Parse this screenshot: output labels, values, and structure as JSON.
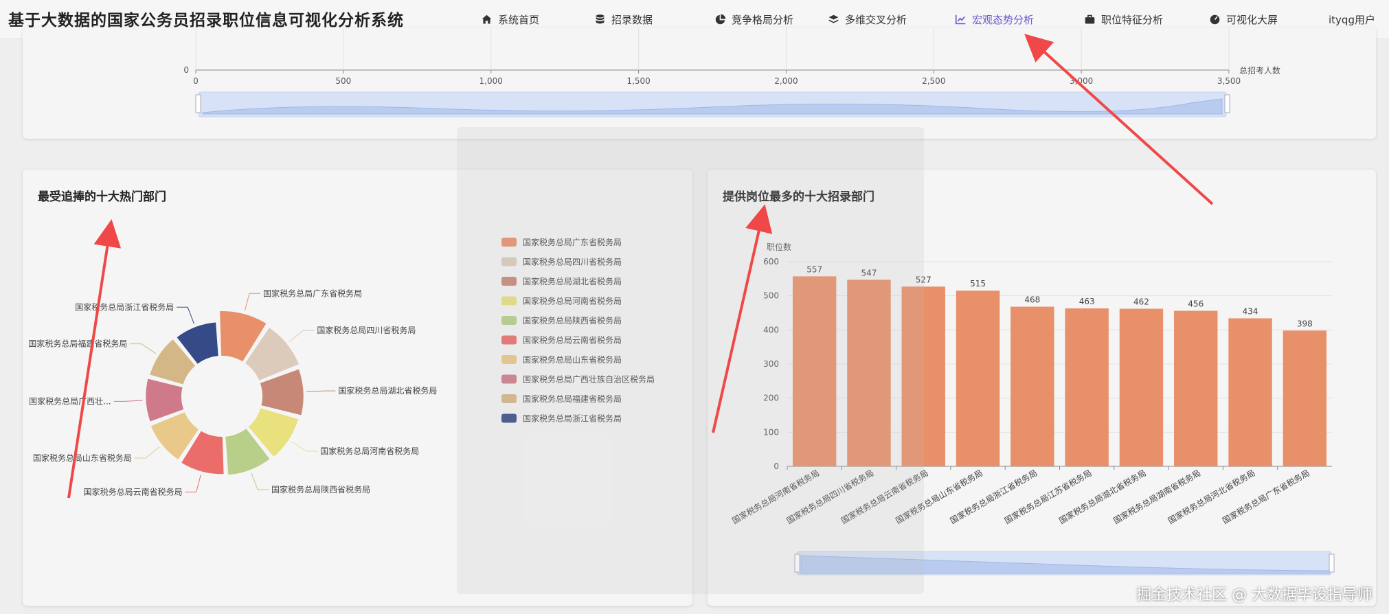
{
  "app": {
    "title": "基于大数据的国家公务员招录职位信息可视化分析系统"
  },
  "nav": {
    "items": [
      {
        "label": "系统首页",
        "icon": "home-icon",
        "active": false
      },
      {
        "label": "招录数据",
        "icon": "database-icon",
        "active": false
      },
      {
        "label": "竞争格局分析",
        "icon": "pie-chart-icon",
        "active": false
      },
      {
        "label": "多维交叉分析",
        "icon": "layers-icon",
        "active": false
      },
      {
        "label": "宏观态势分析",
        "icon": "line-chart-icon",
        "active": true
      },
      {
        "label": "职位特征分析",
        "icon": "briefcase-icon",
        "active": false
      },
      {
        "label": "可视化大屏",
        "icon": "dashboard-icon",
        "active": false
      }
    ],
    "user": "ityqg用户"
  },
  "colors": {
    "accent": "#6a5acd",
    "bar": "#e8906a",
    "pie": [
      "#e8906a",
      "#dccbbb",
      "#c78878",
      "#e9e07e",
      "#b8cf8a",
      "#ea6d6a",
      "#e9c98a",
      "#cf7a8a",
      "#d3b786",
      "#354a86"
    ],
    "arrow": "#f04848"
  },
  "chart_data": [
    {
      "type": "line",
      "title": "",
      "xlabel": "总招考人数",
      "x_ticks": [
        "0",
        "500",
        "1,000",
        "1,500",
        "2,000",
        "2,500",
        "3,000",
        "3,500"
      ],
      "xlim": [
        0,
        3500
      ],
      "y_ticks": [
        "0"
      ],
      "has_datazoom": true
    },
    {
      "type": "pie",
      "title": "最受追捧的十大热门部门",
      "donut": true,
      "labels": [
        "国家税务总局广东省税务局",
        "国家税务总局四川省税务局",
        "国家税务总局湖北省税务局",
        "国家税务总局河南省税务局",
        "国家税务总局陕西省税务局",
        "国家税务总局云南省税务局",
        "国家税务总局山东省税务局",
        "国家税务总局广西壮族自治区税务局",
        "国家税务总局福建省税务局",
        "国家税务总局浙江省税务局"
      ],
      "outer_labels": [
        "国家税务总局广东省税务局",
        "国家税务总局四川省税务局",
        "国家税务总局湖北省税务局",
        "国家税务总局河南省税务局",
        "国家税务总局陕西省税务局",
        "国家税务总局云南省税务局",
        "国家税务总局山东省税务局",
        "国家税务总局广西壮...",
        "国家税务总局福建省税务局",
        "国家税务总局浙江省税务局"
      ],
      "values": [
        1,
        1,
        1,
        1,
        1,
        1,
        1,
        1,
        1,
        1
      ],
      "radius_fraction": [
        1.0,
        0.96,
        0.92,
        0.88,
        0.86,
        0.84,
        0.82,
        0.8,
        0.78,
        0.76
      ],
      "legend": "right"
    },
    {
      "type": "bar",
      "title": "提供岗位最多的十大招录部门",
      "ylabel": "职位数",
      "ylim": [
        0,
        600
      ],
      "y_ticks": [
        0,
        100,
        200,
        300,
        400,
        500,
        600
      ],
      "categories": [
        "国家税务总局河南省税务局",
        "国家税务总局四川省税务局",
        "国家税务总局云南省税务局",
        "国家税务总局山东省税务局",
        "国家税务总局浙江省税务局",
        "国家税务总局江苏省税务局",
        "国家税务总局湖北省税务局",
        "国家税务总局湖南省税务局",
        "国家税务总局河北省税务局",
        "国家税务总局广东省税务局"
      ],
      "values": [
        557,
        547,
        527,
        515,
        468,
        463,
        462,
        456,
        434,
        398
      ],
      "has_datazoom": true
    }
  ],
  "watermark": "掘金技术社区 @ 大数据毕设指导师"
}
